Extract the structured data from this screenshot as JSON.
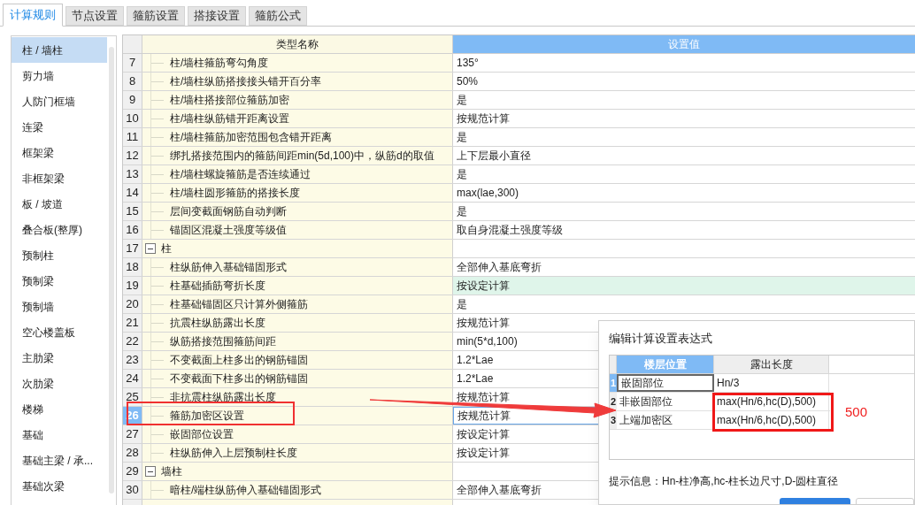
{
  "tabs": [
    {
      "label": "计算规则",
      "selected": true
    },
    {
      "label": "节点设置",
      "selected": false
    },
    {
      "label": "箍筋设置",
      "selected": false
    },
    {
      "label": "搭接设置",
      "selected": false
    },
    {
      "label": "箍筋公式",
      "selected": false
    }
  ],
  "sidebar": {
    "items": [
      {
        "label": "柱 / 墙柱",
        "selected": true
      },
      {
        "label": "剪力墙",
        "selected": false
      },
      {
        "label": "人防门框墙",
        "selected": false
      },
      {
        "label": "连梁",
        "selected": false
      },
      {
        "label": "框架梁",
        "selected": false
      },
      {
        "label": "非框架梁",
        "selected": false
      },
      {
        "label": "板 / 坡道",
        "selected": false
      },
      {
        "label": "叠合板(整厚)",
        "selected": false
      },
      {
        "label": "预制柱",
        "selected": false
      },
      {
        "label": "预制梁",
        "selected": false
      },
      {
        "label": "预制墙",
        "selected": false
      },
      {
        "label": "空心楼盖板",
        "selected": false
      },
      {
        "label": "主肋梁",
        "selected": false
      },
      {
        "label": "次肋梁",
        "selected": false
      },
      {
        "label": "楼梯",
        "selected": false
      },
      {
        "label": "基础",
        "selected": false
      },
      {
        "label": "基础主梁 / 承...",
        "selected": false
      },
      {
        "label": "基础次梁",
        "selected": false
      }
    ]
  },
  "table": {
    "columns": [
      "类型名称",
      "设置值"
    ],
    "rows": [
      {
        "kind": "item",
        "number": "7",
        "name": "柱/墙柱箍筋弯勾角度",
        "value": "135°",
        "selected": false,
        "highlighted": false
      },
      {
        "kind": "item",
        "number": "8",
        "name": "柱/墙柱纵筋搭接接头错开百分率",
        "value": "50%",
        "selected": false,
        "highlighted": false
      },
      {
        "kind": "item",
        "number": "9",
        "name": "柱/墙柱搭接部位箍筋加密",
        "value": "是",
        "selected": false,
        "highlighted": false
      },
      {
        "kind": "item",
        "number": "10",
        "name": "柱/墙柱纵筋错开距离设置",
        "value": "按规范计算",
        "selected": false,
        "highlighted": false
      },
      {
        "kind": "item",
        "number": "11",
        "name": "柱/墙柱箍筋加密范围包含错开距离",
        "value": "是",
        "selected": false,
        "highlighted": false
      },
      {
        "kind": "item",
        "number": "12",
        "name": "绑扎搭接范围内的箍筋间距min(5d,100)中，纵筋d的取值",
        "value": "上下层最小直径",
        "selected": false,
        "highlighted": false
      },
      {
        "kind": "item",
        "number": "13",
        "name": "柱/墙柱螺旋箍筋是否连续通过",
        "value": "是",
        "selected": false,
        "highlighted": false
      },
      {
        "kind": "item",
        "number": "14",
        "name": "柱/墙柱圆形箍筋的搭接长度",
        "value": "max(lae,300)",
        "selected": false,
        "highlighted": false
      },
      {
        "kind": "item",
        "number": "15",
        "name": "层间变截面钢筋自动判断",
        "value": "是",
        "selected": false,
        "highlighted": false
      },
      {
        "kind": "item",
        "number": "16",
        "name": "锚固区混凝土强度等级值",
        "value": "取自身混凝土强度等级",
        "selected": false,
        "highlighted": false
      },
      {
        "kind": "group",
        "number": "17",
        "name": "柱",
        "expanded": true
      },
      {
        "kind": "item",
        "number": "18",
        "name": "柱纵筋伸入基础锚固形式",
        "value": "全部伸入基底弯折",
        "selected": false,
        "highlighted": false
      },
      {
        "kind": "item",
        "number": "19",
        "name": "柱基础插筋弯折长度",
        "value": "按设定计算",
        "selected": false,
        "highlighted": true
      },
      {
        "kind": "item",
        "number": "20",
        "name": "柱基础锚固区只计算外侧箍筋",
        "value": "是",
        "selected": false,
        "highlighted": false
      },
      {
        "kind": "item",
        "number": "21",
        "name": "抗震柱纵筋露出长度",
        "value": "按规范计算",
        "selected": false,
        "highlighted": false
      },
      {
        "kind": "item",
        "number": "22",
        "name": "纵筋搭接范围箍筋间距",
        "value": "min(5*d,100)",
        "selected": false,
        "highlighted": false
      },
      {
        "kind": "item",
        "number": "23",
        "name": "不变截面上柱多出的钢筋锚固",
        "value": "1.2*Lae",
        "selected": false,
        "highlighted": false
      },
      {
        "kind": "item",
        "number": "24",
        "name": "不变截面下柱多出的钢筋锚固",
        "value": "1.2*Lae",
        "selected": false,
        "highlighted": false
      },
      {
        "kind": "item",
        "number": "25",
        "name": "非抗震柱纵筋露出长度",
        "value": "按规范计算",
        "selected": false,
        "highlighted": false
      },
      {
        "kind": "item",
        "number": "26",
        "name": "箍筋加密区设置",
        "value": "按规范计算",
        "selected": true,
        "highlighted": false
      },
      {
        "kind": "item",
        "number": "27",
        "name": "嵌固部位设置",
        "value": "按设定计算",
        "selected": false,
        "highlighted": false
      },
      {
        "kind": "item",
        "number": "28",
        "name": "柱纵筋伸入上层预制柱长度",
        "value": "按设定计算",
        "selected": false,
        "highlighted": false
      },
      {
        "kind": "group",
        "number": "29",
        "name": "墙柱",
        "expanded": true
      },
      {
        "kind": "item",
        "number": "30",
        "name": "暗柱/端柱纵筋伸入基础锚固形式",
        "value": "全部伸入基底弯折",
        "selected": false,
        "highlighted": false
      }
    ]
  },
  "dialog": {
    "title": "编辑计算设置表达式",
    "table": {
      "columns": [
        {
          "label": "楼层位置",
          "selected": true
        },
        {
          "label": "露出长度",
          "selected": false
        }
      ],
      "rows": [
        {
          "number": "1",
          "position": "嵌固部位",
          "length": "Hn/3",
          "selected": true
        },
        {
          "number": "2",
          "position": "非嵌固部位",
          "length": "max(Hn/6,hc(D),500)",
          "selected": false
        },
        {
          "number": "3",
          "position": "上端加密区",
          "length": "max(Hn/6,hc(D),500)",
          "selected": false
        }
      ]
    },
    "hint": "提示信息：Hn-柱净高,hc-柱长边尺寸,D-圆柱直径"
  },
  "annotation": {
    "note": "500"
  }
}
